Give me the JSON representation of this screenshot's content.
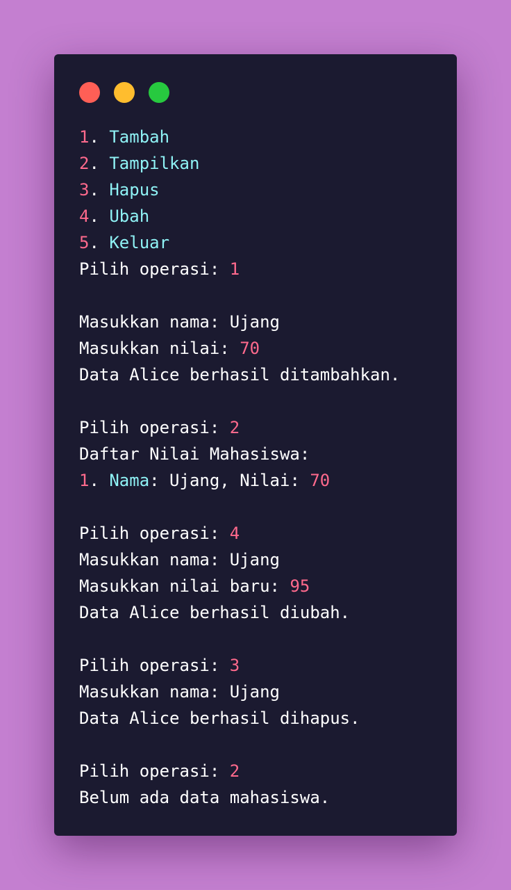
{
  "colors": {
    "background": "#c47fd0",
    "panel": "#1b1a30",
    "text": "#ffffff",
    "number": "#ff6a8d",
    "keyword": "#8ff2f5",
    "dot_red": "#ff5f56",
    "dot_yellow": "#ffbd2e",
    "dot_green": "#27c93f"
  },
  "window_controls": [
    {
      "name": "close-dot",
      "color": "dot_red"
    },
    {
      "name": "minimize-dot",
      "color": "dot_yellow"
    },
    {
      "name": "maximize-dot",
      "color": "dot_green"
    }
  ],
  "console_lines": [
    [
      {
        "t": "1",
        "c": "number"
      },
      {
        "t": ". ",
        "c": "text"
      },
      {
        "t": "Tambah",
        "c": "keyword"
      }
    ],
    [
      {
        "t": "2",
        "c": "number"
      },
      {
        "t": ". ",
        "c": "text"
      },
      {
        "t": "Tampilkan",
        "c": "keyword"
      }
    ],
    [
      {
        "t": "3",
        "c": "number"
      },
      {
        "t": ". ",
        "c": "text"
      },
      {
        "t": "Hapus",
        "c": "keyword"
      }
    ],
    [
      {
        "t": "4",
        "c": "number"
      },
      {
        "t": ". ",
        "c": "text"
      },
      {
        "t": "Ubah",
        "c": "keyword"
      }
    ],
    [
      {
        "t": "5",
        "c": "number"
      },
      {
        "t": ". ",
        "c": "text"
      },
      {
        "t": "Keluar",
        "c": "keyword"
      }
    ],
    [
      {
        "t": "Pilih operasi: ",
        "c": "text"
      },
      {
        "t": "1",
        "c": "number"
      }
    ],
    [],
    [
      {
        "t": "Masukkan nama: Ujang",
        "c": "text"
      }
    ],
    [
      {
        "t": "Masukkan nilai: ",
        "c": "text"
      },
      {
        "t": "70",
        "c": "number"
      }
    ],
    [
      {
        "t": "Data Alice berhasil ditambahkan.",
        "c": "text"
      }
    ],
    [],
    [
      {
        "t": "Pilih operasi: ",
        "c": "text"
      },
      {
        "t": "2",
        "c": "number"
      }
    ],
    [
      {
        "t": "Daftar Nilai Mahasiswa:",
        "c": "text"
      }
    ],
    [
      {
        "t": "1",
        "c": "number"
      },
      {
        "t": ". ",
        "c": "text"
      },
      {
        "t": "Nama",
        "c": "keyword"
      },
      {
        "t": ": Ujang, Nilai: ",
        "c": "text"
      },
      {
        "t": "70",
        "c": "number"
      }
    ],
    [],
    [
      {
        "t": "Pilih operasi: ",
        "c": "text"
      },
      {
        "t": "4",
        "c": "number"
      }
    ],
    [
      {
        "t": "Masukkan nama: Ujang",
        "c": "text"
      }
    ],
    [
      {
        "t": "Masukkan nilai baru: ",
        "c": "text"
      },
      {
        "t": "95",
        "c": "number"
      }
    ],
    [
      {
        "t": "Data Alice berhasil diubah.",
        "c": "text"
      }
    ],
    [],
    [
      {
        "t": "Pilih operasi: ",
        "c": "text"
      },
      {
        "t": "3",
        "c": "number"
      }
    ],
    [
      {
        "t": "Masukkan nama: Ujang",
        "c": "text"
      }
    ],
    [
      {
        "t": "Data Alice berhasil dihapus.",
        "c": "text"
      }
    ],
    [],
    [
      {
        "t": "Pilih operasi: ",
        "c": "text"
      },
      {
        "t": "2",
        "c": "number"
      }
    ],
    [
      {
        "t": "Belum ada data mahasiswa.",
        "c": "text"
      }
    ]
  ]
}
